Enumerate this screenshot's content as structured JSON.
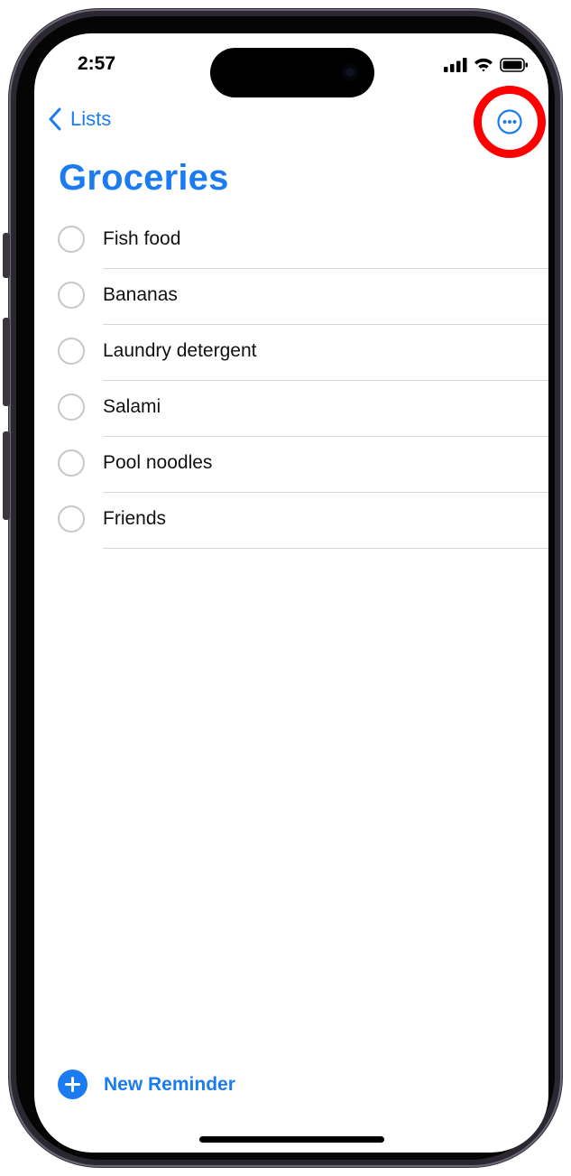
{
  "status_bar": {
    "time": "2:57"
  },
  "nav": {
    "back_label": "Lists"
  },
  "page": {
    "title": "Groceries"
  },
  "reminders": [
    {
      "label": "Fish food"
    },
    {
      "label": "Bananas"
    },
    {
      "label": "Laundry detergent"
    },
    {
      "label": "Salami"
    },
    {
      "label": "Pool noodles"
    },
    {
      "label": "Friends"
    }
  ],
  "footer": {
    "new_reminder_label": "New Reminder"
  },
  "colors": {
    "accent": "#1a7cf0",
    "highlight_ring": "#ff0000"
  },
  "icons": [
    "chevron-left-icon",
    "ellipsis-circle-icon",
    "plus-circle-icon",
    "cellular-signal-icon",
    "wifi-icon",
    "battery-icon"
  ]
}
